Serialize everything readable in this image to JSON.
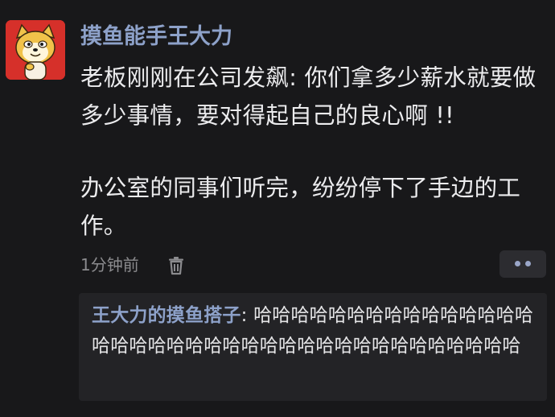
{
  "post": {
    "author": "摸鱼能手王大力",
    "paragraph1": "老板刚刚在公司发飙: 你们拿多少薪水就要做多少事情，要对得起自己的良心啊 !!",
    "paragraph2": "办公室的同事们听完，纷纷停下了手边的工作。",
    "time": "1分钟前"
  },
  "reply": {
    "author": "王大力的摸鱼搭子",
    "separator": ": ",
    "text": "哈哈哈哈哈哈哈哈哈哈哈哈哈哈哈哈哈哈哈哈哈哈哈哈哈哈哈哈哈哈哈哈哈哈哈哈哈哈"
  },
  "icons": {
    "avatar": "shiba-doge-avatar",
    "delete": "trash-icon",
    "more": "more-dots-icon"
  },
  "colors": {
    "background": "#18181a",
    "author_name": "#8da1c9",
    "avatar_bg": "#d6302a",
    "reply_bg": "#232326"
  }
}
